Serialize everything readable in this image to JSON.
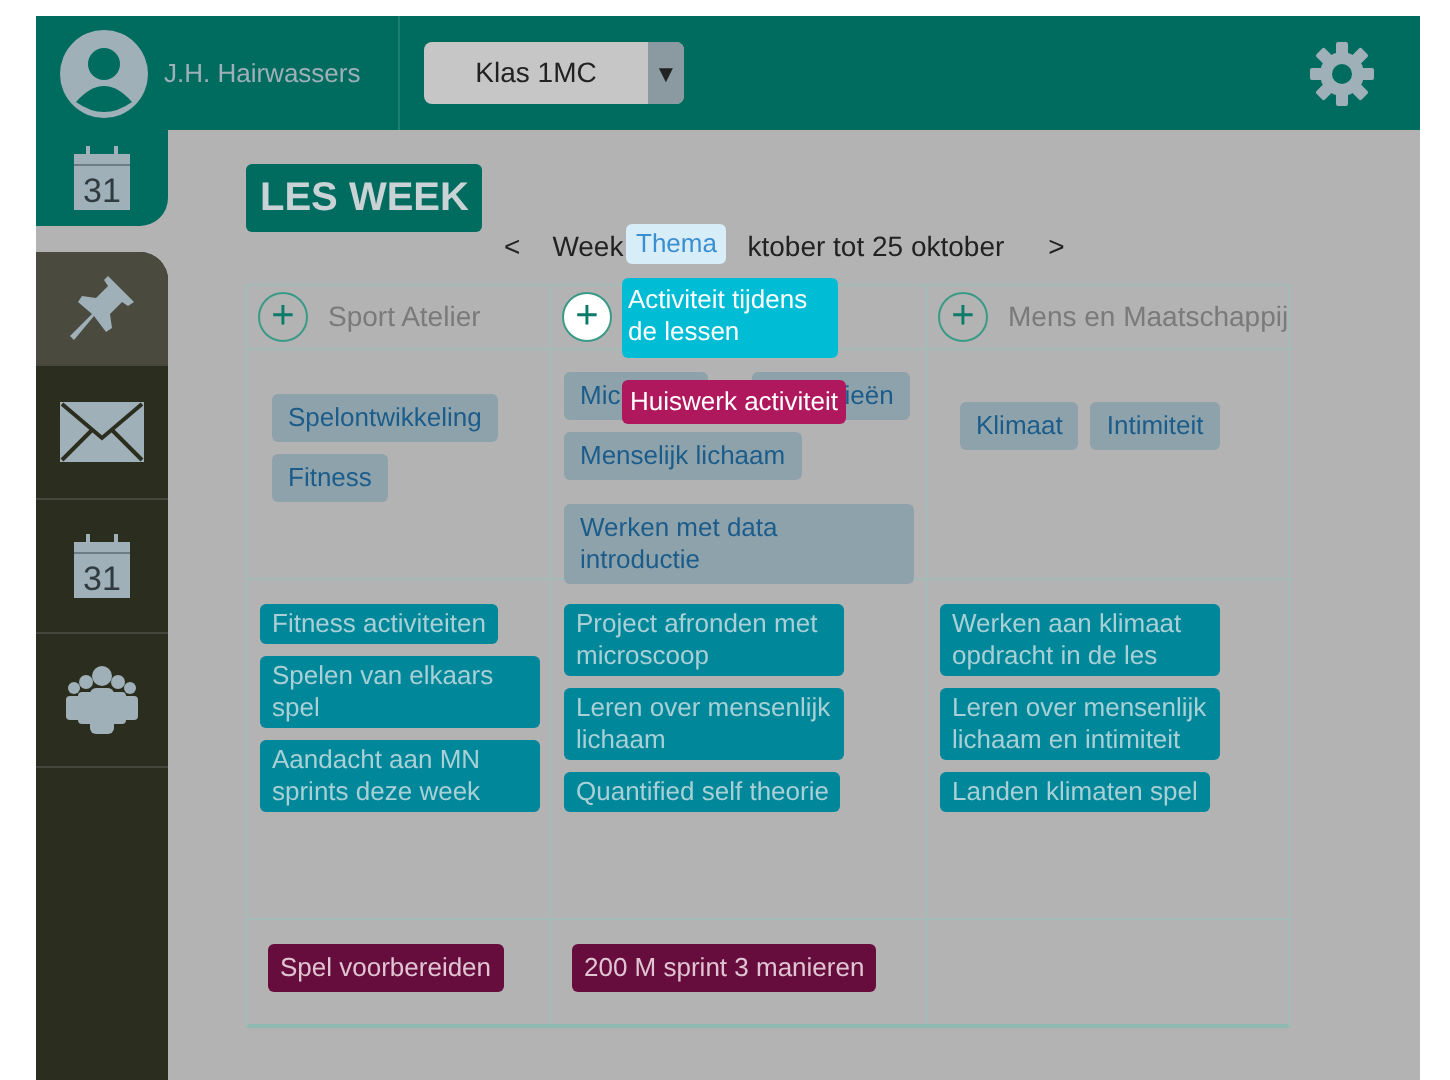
{
  "header": {
    "user_name": "J.H. Hairwassers",
    "class_select": {
      "value": "Klas 1MC",
      "arrow": "▼"
    }
  },
  "sidebar": {
    "items": [
      {
        "kind": "calendar",
        "label": "31",
        "selected": true,
        "hovered": false
      },
      {
        "kind": "pin",
        "selected": false,
        "hovered": true
      },
      {
        "kind": "mail",
        "selected": false,
        "hovered": false
      },
      {
        "kind": "calendar",
        "label": "31",
        "selected": false,
        "hovered": false
      },
      {
        "kind": "people",
        "selected": false,
        "hovered": false
      }
    ]
  },
  "page": {
    "title": "LES WEEK",
    "week_nav": {
      "prev": "<",
      "label_before": "Week",
      "label_after": "ktober tot 25 oktober",
      "next": ">"
    }
  },
  "subjects": [
    {
      "name": "Sport Atelier",
      "add": "+",
      "add_highlighted": false,
      "topics": [
        "Spelontwikkeling",
        "Fitness"
      ],
      "activities": [
        "Fitness activiteiten",
        "Spelen van elkaars spel",
        "Aandacht aan MN sprints deze week"
      ],
      "homework": [
        "Spel voorbereiden"
      ]
    },
    {
      "add": "+",
      "add_highlighted": true,
      "topics": [
        "Mic",
        "ieën",
        "Menselijk lichaam",
        "Werken met data introductie"
      ],
      "activities": [
        "Project afronden met microscoop",
        "Leren over mensenlijk lichaam",
        "Quantified self theorie"
      ],
      "homework": [
        "200 M sprint 3 manieren"
      ]
    },
    {
      "name": "Mens en Maatschappij",
      "add": "+",
      "add_highlighted": false,
      "topics": [
        "Klimaat",
        "Intimiteit"
      ],
      "activities": [
        "Werken aan klimaat opdracht in de les",
        "Leren over mensenlijk lichaam en intimiteit",
        "Landen klimaten spel"
      ]
    }
  ],
  "add_menu": {
    "items": [
      {
        "kind": "theme",
        "label": "Thema"
      },
      {
        "kind": "activity",
        "label": "Activiteit tijdens de lessen"
      },
      {
        "kind": "homework",
        "label": "Huiswerk activiteit"
      }
    ]
  }
}
